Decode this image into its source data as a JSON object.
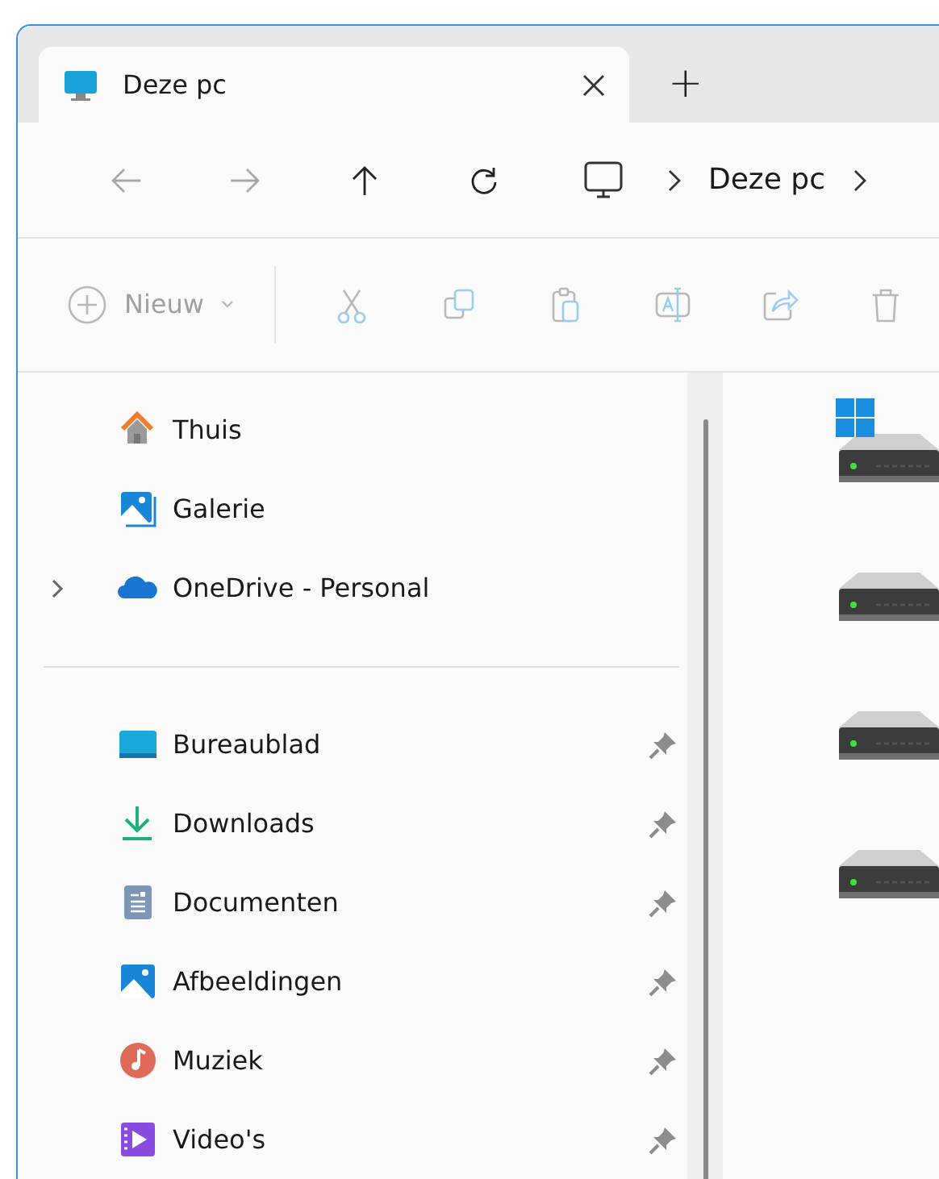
{
  "tabs": [
    {
      "title": "Deze pc",
      "selected": true
    }
  ],
  "new_tab": "+",
  "nav": {
    "back_disabled": true,
    "forward_disabled": true
  },
  "breadcrumb": [
    "Deze pc"
  ],
  "toolbar": {
    "new_label": "Nieuw",
    "disabled": true
  },
  "sidebar": {
    "groups": [
      {
        "items": [
          {
            "kind": "home",
            "label": "Thuis",
            "expandable": false,
            "pinned": false
          },
          {
            "kind": "gallery",
            "label": "Galerie",
            "expandable": false,
            "pinned": false
          },
          {
            "kind": "onedrive",
            "label": "OneDrive - Personal",
            "expandable": true,
            "pinned": false
          }
        ]
      },
      {
        "items": [
          {
            "kind": "desktop",
            "label": "Bureaublad",
            "expandable": false,
            "pinned": true
          },
          {
            "kind": "downloads",
            "label": "Downloads",
            "expandable": false,
            "pinned": true
          },
          {
            "kind": "documents",
            "label": "Documenten",
            "expandable": false,
            "pinned": true
          },
          {
            "kind": "pictures",
            "label": "Afbeeldingen",
            "expandable": false,
            "pinned": true
          },
          {
            "kind": "music",
            "label": "Muziek",
            "expandable": false,
            "pinned": true
          },
          {
            "kind": "videos",
            "label": "Video's",
            "expandable": false,
            "pinned": true
          }
        ]
      }
    ]
  },
  "drives": [
    {
      "kind": "system"
    },
    {
      "kind": "drive"
    },
    {
      "kind": "drive"
    },
    {
      "kind": "drive"
    }
  ]
}
